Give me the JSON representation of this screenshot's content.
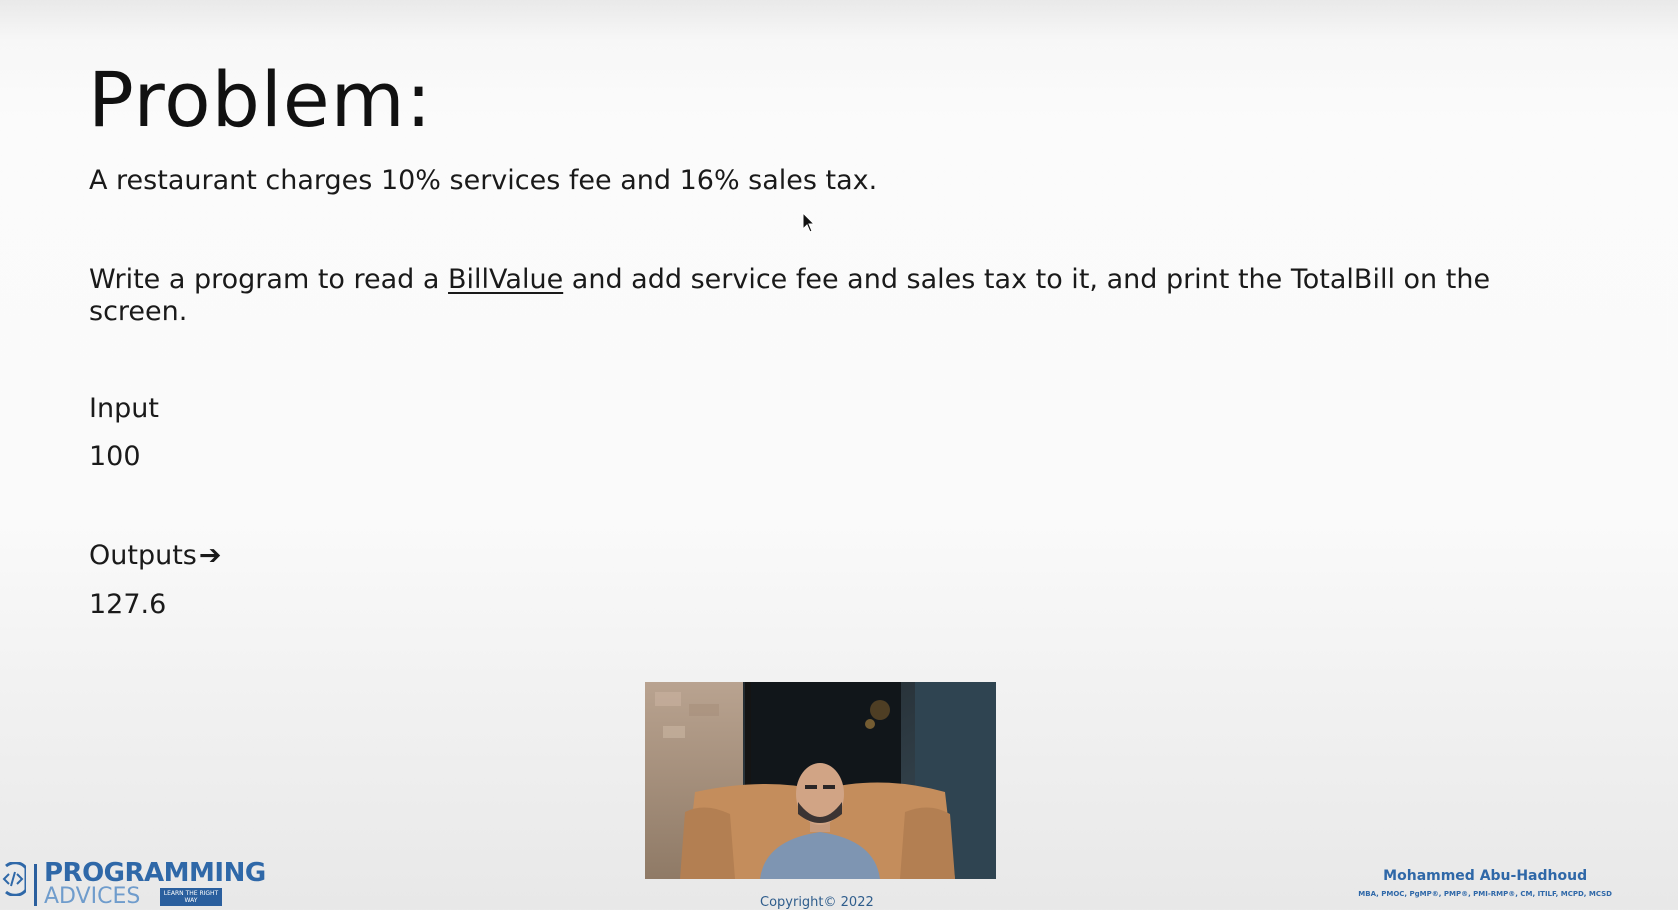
{
  "slide": {
    "title": "Problem:",
    "problem_statement": "A restaurant charges 10% services fee and 16% sales tax.",
    "task_before": "Write a program to read a ",
    "task_underlined": "BillValue",
    "task_after": " and add service fee and sales tax to it, and print the TotalBill on the screen.",
    "input_label": "Input",
    "input_value": "100",
    "output_label": "Outputs",
    "output_arrow": "➔",
    "output_value": "127.6"
  },
  "footer": {
    "copyright": "Copyright© 2022",
    "logo_main": "PROGRAMMING",
    "logo_sub": "ADVICES",
    "logo_tag": "LEARN THE RIGHT WAY",
    "author_name": "Mohammed Abu-Hadhoud",
    "author_credentials": "MBA, PMOC, PgMP®, PMP®, PMI-RMP®, CM, ITILF, MCPD, MCSD"
  },
  "colors": {
    "brand_blue": "#2f68a8",
    "text": "#1a1a1a"
  },
  "icons": {
    "cursor": "mouse-pointer-icon",
    "logo": "code-brackets-icon"
  }
}
